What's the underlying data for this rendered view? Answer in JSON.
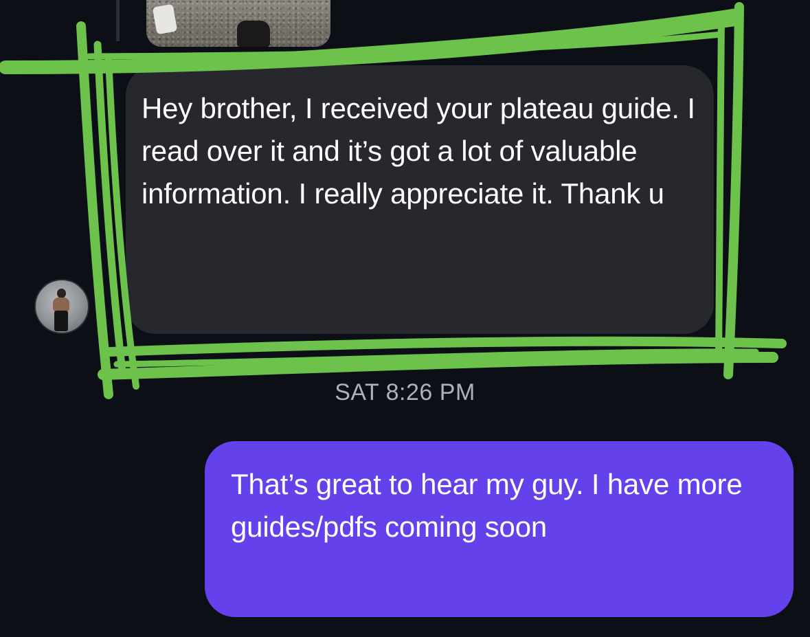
{
  "conversation": {
    "received_message": {
      "text": "Hey brother, I received your plateau guide. I read over it and it’s got a lot of valuable information. I really appreciate it. Thank u"
    },
    "timestamp": "SAT 8:26 PM",
    "sent_message": {
      "text": "That’s great to hear my guy. I have more guides/pdfs coming soon"
    }
  },
  "colors": {
    "background": "#0c0f16",
    "received_bubble": "#26282e",
    "sent_bubble": "#6441ea",
    "highlight": "#6cc24a",
    "timestamp": "#aeb1b8"
  },
  "icons": {
    "avatar": "profile-photo",
    "previous_attachment": "photo-thumbnail"
  }
}
